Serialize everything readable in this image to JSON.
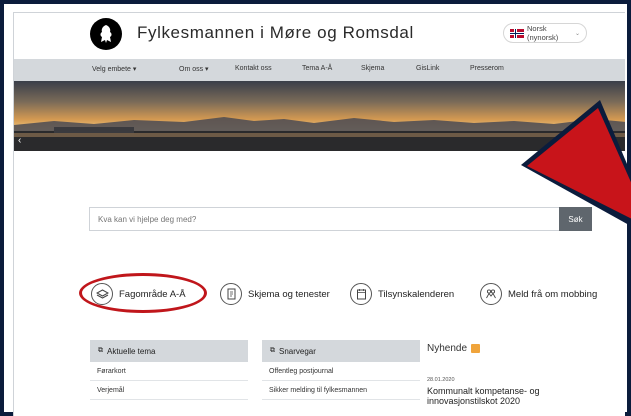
{
  "header": {
    "title": "Fylkesmannen i Møre og Romsdal",
    "language": "Norsk (nynorsk)"
  },
  "nav": {
    "items": [
      "Velg embete ▾",
      "Om oss ▾",
      "Kontakt oss",
      "Tema A-Å",
      "Skjema",
      "GisLink",
      "Presserom"
    ]
  },
  "search": {
    "placeholder": "Kva kan vi hjelpe deg med?",
    "button": "Søk"
  },
  "quick_links": [
    {
      "label": "Fagområde A-Å",
      "icon": "layers-icon"
    },
    {
      "label": "Skjema og tenester",
      "icon": "form-icon"
    },
    {
      "label": "Tilsynskalenderen",
      "icon": "calendar-icon"
    },
    {
      "label": "Meld frå om mobbing",
      "icon": "people-icon"
    }
  ],
  "panels": {
    "aktuelle": {
      "title": "Aktuelle tema",
      "rows": [
        "Førarkort",
        "Verjemål"
      ]
    },
    "snarvegar": {
      "title": "Snarvegar",
      "rows": [
        "Offentleg postjournal",
        "Sikker melding til fylkesmannen"
      ]
    }
  },
  "news": {
    "title": "Nyhende",
    "date": "28.01.2020",
    "headline": "Kommunalt kompetanse- og innovasjonstilskot 2020"
  },
  "colors": {
    "nav_bg": "#d4d8dc",
    "highlight": "#c0161b",
    "frame": "#0b1c3c",
    "search_button": "#5f666d"
  }
}
